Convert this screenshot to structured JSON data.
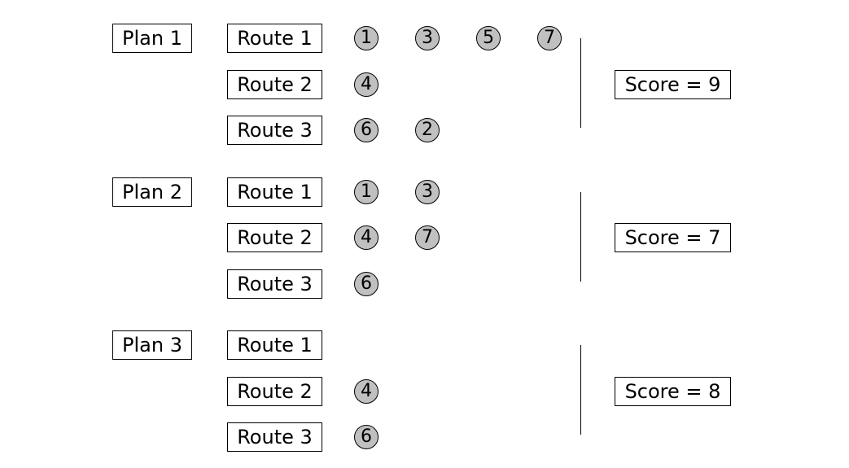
{
  "plans": [
    {
      "label": "Plan 1",
      "routes": [
        {
          "label": "Route 1",
          "nodes": [
            "1",
            "3",
            "5",
            "7"
          ]
        },
        {
          "label": "Route 2",
          "nodes": [
            "4"
          ]
        },
        {
          "label": "Route 3",
          "nodes": [
            "6",
            "2"
          ]
        }
      ],
      "score": "Score = 9"
    },
    {
      "label": "Plan 2",
      "routes": [
        {
          "label": "Route 1",
          "nodes": [
            "1",
            "3"
          ]
        },
        {
          "label": "Route 2",
          "nodes": [
            "4",
            "7"
          ]
        },
        {
          "label": "Route 3",
          "nodes": [
            "6"
          ]
        }
      ],
      "score": "Score = 7"
    },
    {
      "label": "Plan 3",
      "routes": [
        {
          "label": "Route 1",
          "nodes": []
        },
        {
          "label": "Route 2",
          "nodes": [
            "4"
          ]
        },
        {
          "label": "Route 3",
          "nodes": [
            "6"
          ]
        }
      ],
      "score": "Score = 8"
    }
  ],
  "colors": {
    "node_fill": "#c0c0c0",
    "stroke": "#000000",
    "background": "#ffffff"
  }
}
